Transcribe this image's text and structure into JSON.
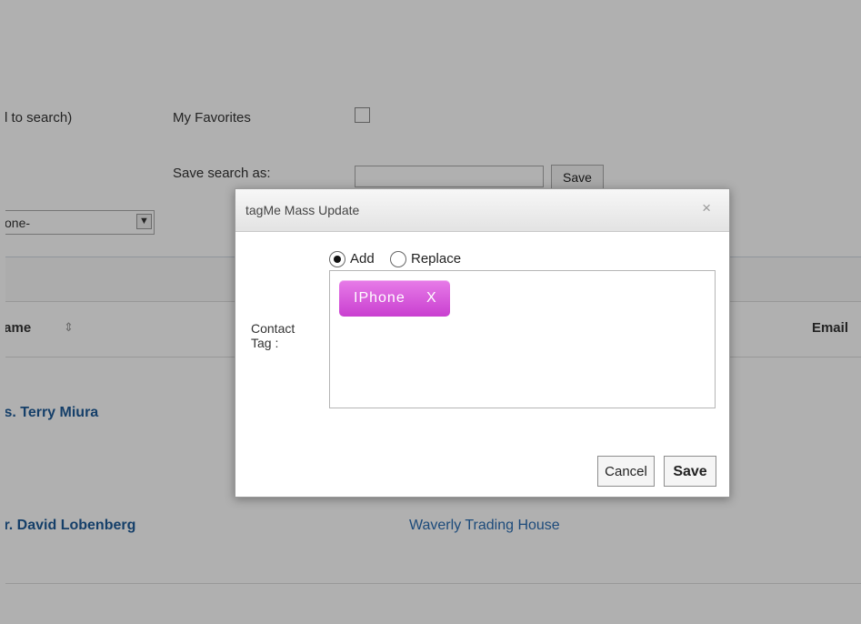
{
  "search": {
    "partial_label": "d to search)",
    "favorites_label": "My Favorites",
    "save_search_label": "Save search as:",
    "save_search_value": "",
    "save_button": "Save",
    "select_value": "one-"
  },
  "table": {
    "name_header": "lame",
    "email_header": "Email",
    "rows": [
      {
        "name": "ls. Terry Miura",
        "company": ""
      },
      {
        "name": "Ir. David Lobenberg",
        "company": "Waverly Trading House"
      }
    ]
  },
  "dialog": {
    "title": "tagMe Mass Update",
    "close_glyph": "×",
    "mode_options": [
      "Add",
      "Replace"
    ],
    "mode_selected": "Add",
    "field_label": "Contact Tag :",
    "tags": [
      {
        "label": "IPhone",
        "remove": "X",
        "color": "#d454d9"
      }
    ],
    "cancel_button": "Cancel",
    "save_button": "Save"
  },
  "colors": {
    "link": "#1f5c99",
    "tag_chip": "#d454d9",
    "overlay": "rgba(0,0,0,0.31)"
  }
}
